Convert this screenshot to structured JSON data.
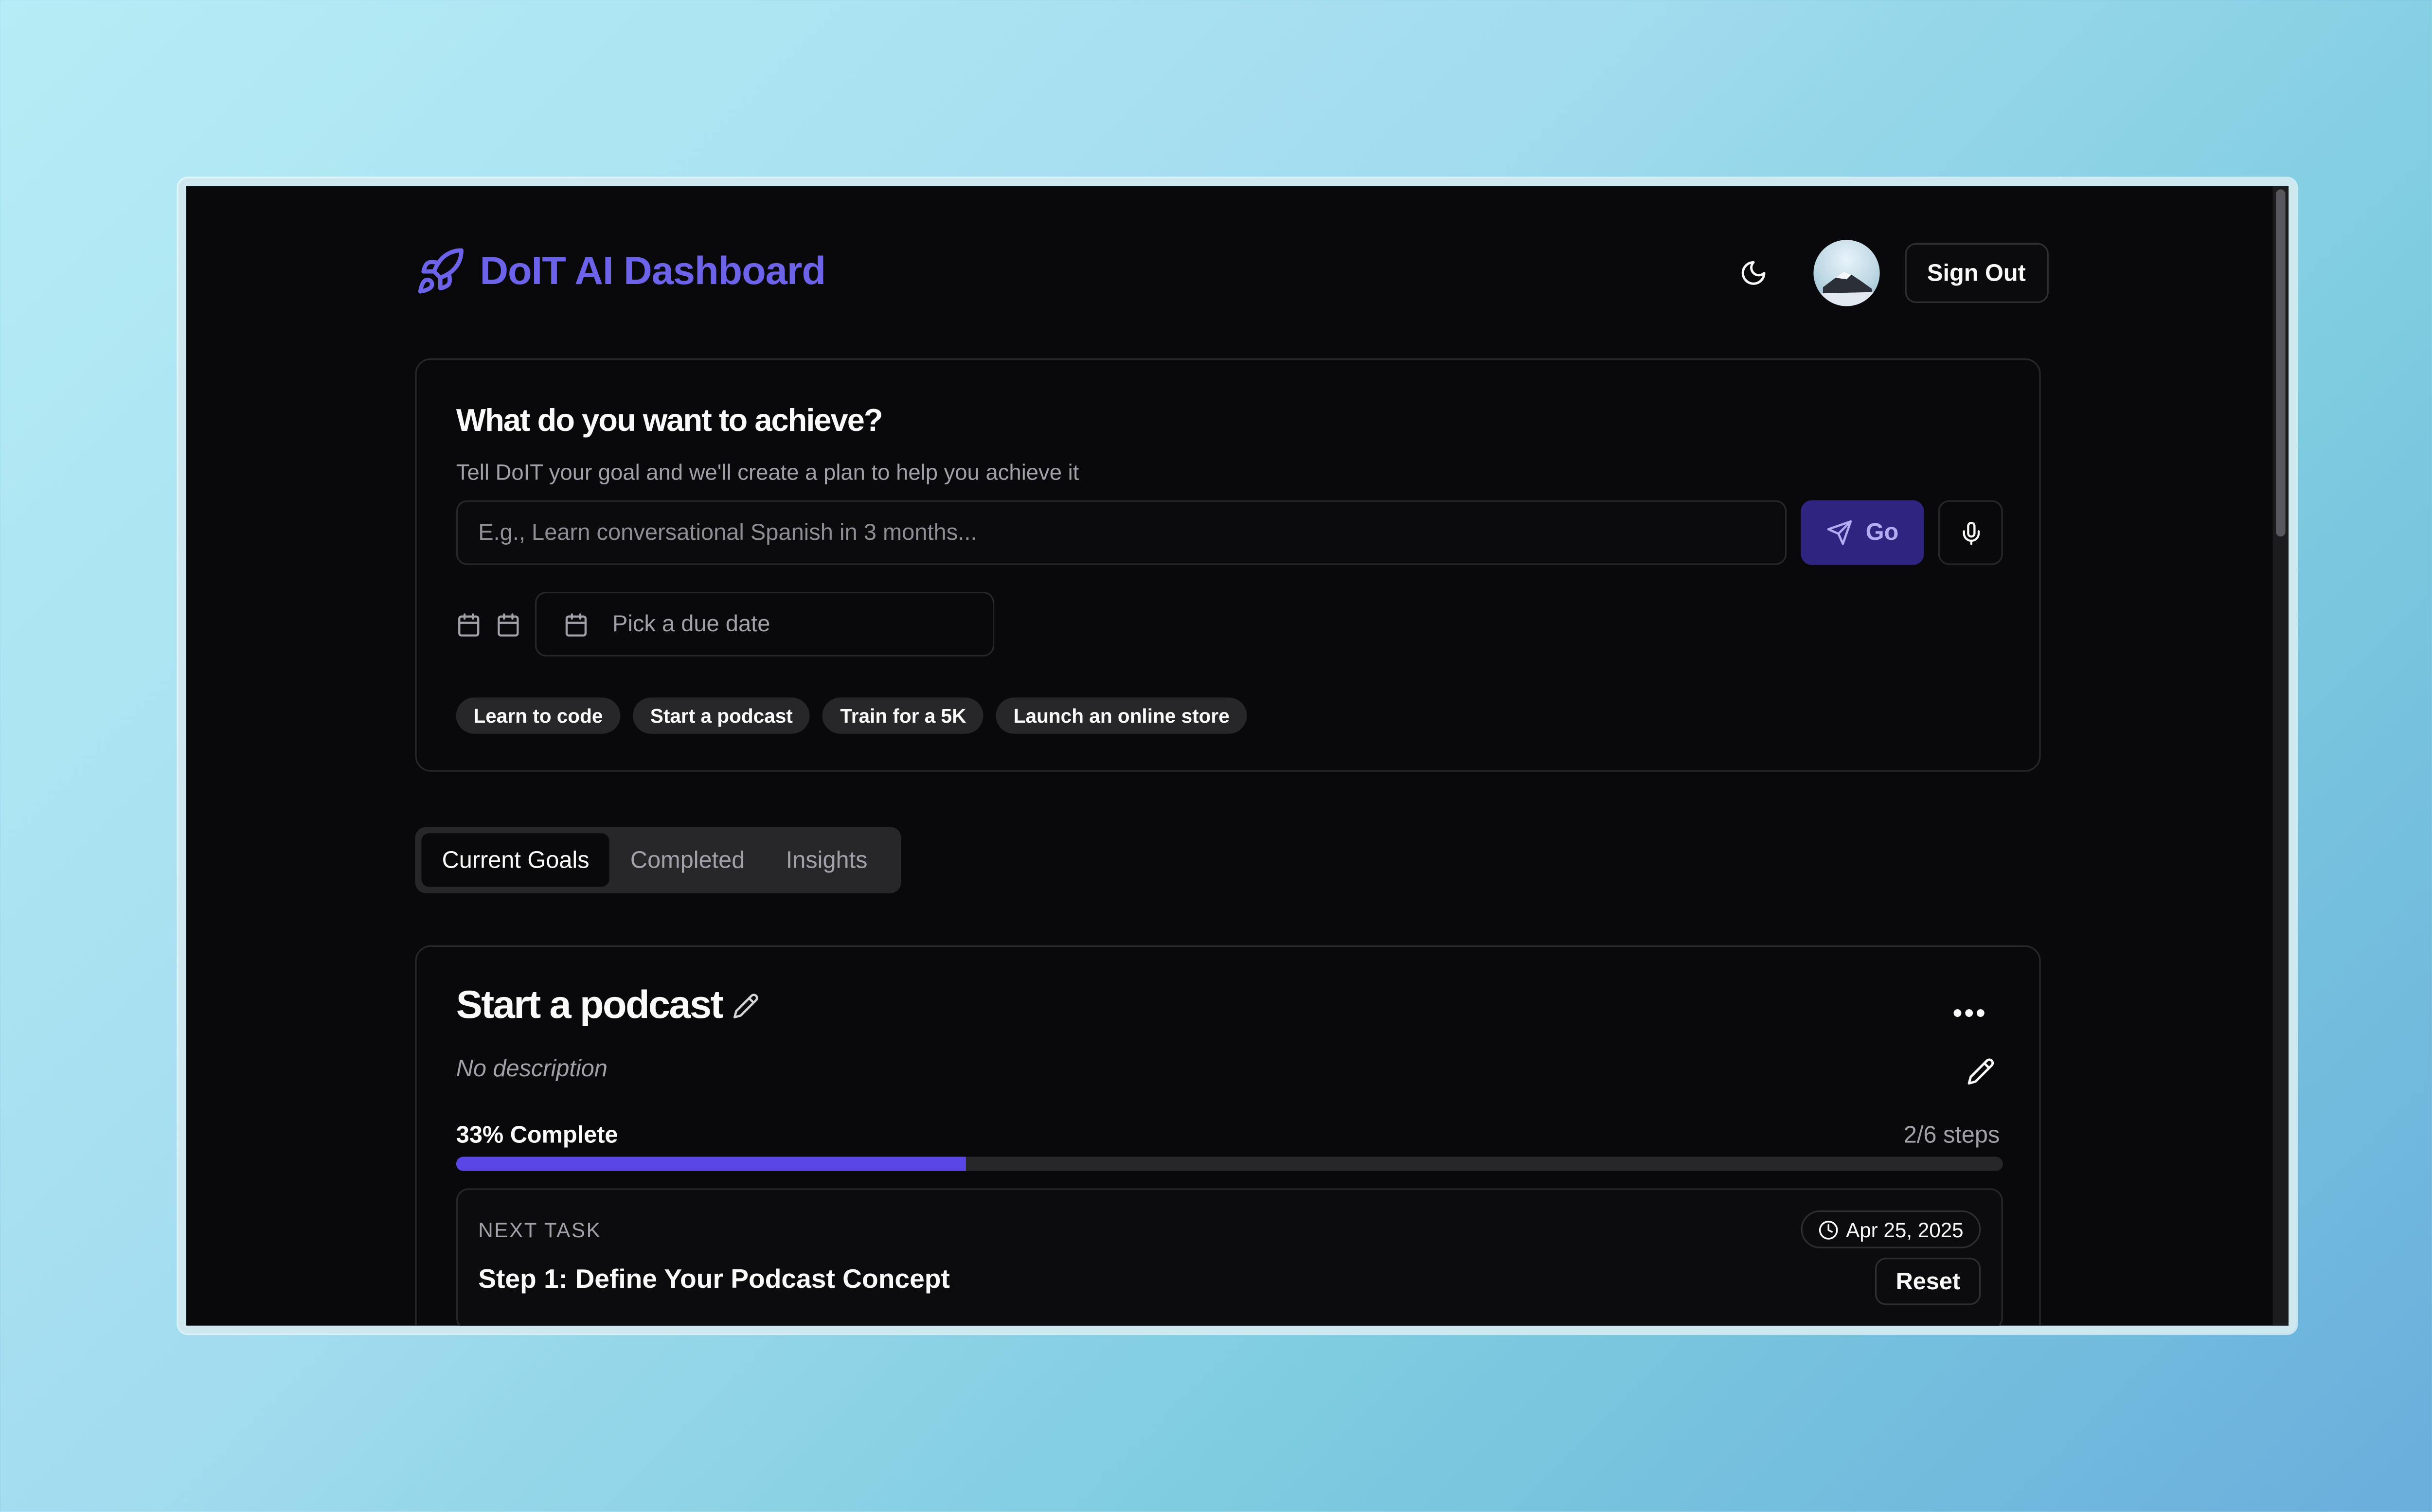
{
  "header": {
    "title": "DoIT AI Dashboard",
    "brand_color": "#6d63ea",
    "theme_icon": "moon-icon",
    "sign_out_label": "Sign Out"
  },
  "goal_form": {
    "heading": "What do you want to achieve?",
    "subheading": "Tell DoIT your goal and we'll create a plan to help you achieve it",
    "input_placeholder": "E.g., Learn conversational Spanish in 3 months...",
    "go_label": "Go",
    "due_date_placeholder": "Pick a due date",
    "suggestions": [
      "Learn to code",
      "Start a podcast",
      "Train for a 5K",
      "Launch an online store"
    ]
  },
  "tabs": [
    {
      "label": "Current Goals",
      "active": true
    },
    {
      "label": "Completed",
      "active": false
    },
    {
      "label": "Insights",
      "active": false
    }
  ],
  "goal_card": {
    "title": "Start a podcast",
    "description": "No description",
    "progress_label": "33% Complete",
    "progress_fraction": 0.33,
    "steps_label": "2/6 steps",
    "next_task": {
      "label": "NEXT TASK",
      "due_date": "Apr 25, 2025",
      "title": "Step 1: Define Your Podcast Concept",
      "reset_label": "Reset"
    }
  },
  "colors": {
    "background": "#09090b",
    "accent": "#5a46e6",
    "go_button": "#2f2480"
  }
}
